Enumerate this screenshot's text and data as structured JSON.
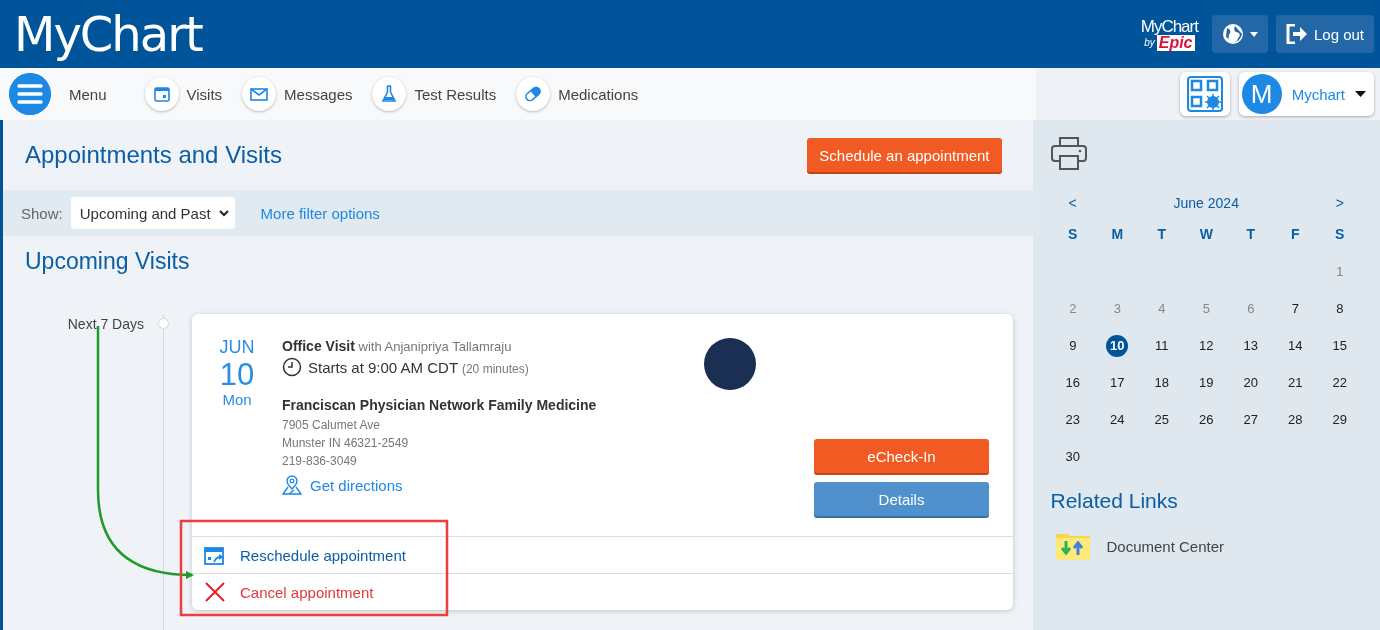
{
  "header": {
    "logo": "MyChart",
    "brand": {
      "name": "MyChart",
      "by": "by",
      "vendor": "Epic"
    },
    "logout": "Log out"
  },
  "nav": {
    "menu": "Menu",
    "items": [
      {
        "label": "Visits"
      },
      {
        "label": "Messages"
      },
      {
        "label": "Test Results"
      },
      {
        "label": "Medications"
      }
    ],
    "user": {
      "initial": "M",
      "name": "Mychart"
    }
  },
  "page": {
    "title": "Appointments and Visits",
    "schedule_button": "Schedule an appointment"
  },
  "filter": {
    "label": "Show:",
    "value": "Upcoming and Past",
    "more": "More filter options"
  },
  "upcoming": {
    "title": "Upcoming Visits",
    "groups": [
      {
        "label": "Next 7 Days",
        "appointments": [
          {
            "month": "JUN",
            "day": "10",
            "weekday": "Mon",
            "type": "Office Visit",
            "provider": "with Anjanipriya Tallamraju",
            "time": "Starts at 9:00 AM CDT",
            "duration": "(20 minutes)",
            "location": "Franciscan Physician Network Family Medicine",
            "address_lines": [
              "7905 Calumet Ave",
              "Munster IN 46321-2549",
              "219-836-3049"
            ],
            "directions": "Get directions",
            "buttons": [
              {
                "label": "eCheck-In",
                "kind": "primary"
              },
              {
                "label": "Details",
                "kind": "secondary"
              }
            ],
            "actions": [
              {
                "label": "Reschedule appointment",
                "kind": "reschedule"
              },
              {
                "label": "Cancel appointment",
                "kind": "cancel"
              }
            ]
          }
        ]
      }
    ]
  },
  "sidebar": {
    "calendar": {
      "prev": "<",
      "month": "June 2024",
      "next": ">",
      "weekdays": [
        "S",
        "M",
        "T",
        "W",
        "T",
        "F",
        "S"
      ],
      "weeks": [
        {
          "kind": "leading",
          "days": [
            {
              "day": "1",
              "disabled": true,
              "selected": false
            }
          ]
        },
        {
          "kind": "full",
          "days": [
            {
              "day": "2",
              "disabled": true,
              "selected": false
            },
            {
              "day": "3",
              "disabled": true,
              "selected": false
            },
            {
              "day": "4",
              "disabled": true,
              "selected": false
            },
            {
              "day": "5",
              "disabled": true,
              "selected": false
            },
            {
              "day": "6",
              "disabled": true,
              "selected": false
            },
            {
              "day": "7",
              "disabled": false,
              "selected": false
            },
            {
              "day": "8",
              "disabled": false,
              "selected": false
            }
          ]
        },
        {
          "kind": "full",
          "days": [
            {
              "day": "9",
              "disabled": false,
              "selected": false
            },
            {
              "day": "10",
              "disabled": false,
              "selected": true
            },
            {
              "day": "11",
              "disabled": false,
              "selected": false
            },
            {
              "day": "12",
              "disabled": false,
              "selected": false
            },
            {
              "day": "13",
              "disabled": false,
              "selected": false
            },
            {
              "day": "14",
              "disabled": false,
              "selected": false
            },
            {
              "day": "15",
              "disabled": false,
              "selected": false
            }
          ]
        },
        {
          "kind": "full",
          "days": [
            {
              "day": "16",
              "disabled": false,
              "selected": false
            },
            {
              "day": "17",
              "disabled": false,
              "selected": false
            },
            {
              "day": "18",
              "disabled": false,
              "selected": false
            },
            {
              "day": "19",
              "disabled": false,
              "selected": false
            },
            {
              "day": "20",
              "disabled": false,
              "selected": false
            },
            {
              "day": "21",
              "disabled": false,
              "selected": false
            },
            {
              "day": "22",
              "disabled": false,
              "selected": false
            }
          ]
        },
        {
          "kind": "full",
          "days": [
            {
              "day": "23",
              "disabled": false,
              "selected": false
            },
            {
              "day": "24",
              "disabled": false,
              "selected": false
            },
            {
              "day": "25",
              "disabled": false,
              "selected": false
            },
            {
              "day": "26",
              "disabled": false,
              "selected": false
            },
            {
              "day": "27",
              "disabled": false,
              "selected": false
            },
            {
              "day": "28",
              "disabled": false,
              "selected": false
            },
            {
              "day": "29",
              "disabled": false,
              "selected": false
            }
          ]
        },
        {
          "kind": "trailing",
          "days": [
            {
              "day": "30",
              "disabled": false,
              "selected": false
            }
          ]
        }
      ]
    },
    "related_links": {
      "title": "Related Links",
      "items": [
        {
          "label": "Document Center"
        }
      ]
    }
  }
}
